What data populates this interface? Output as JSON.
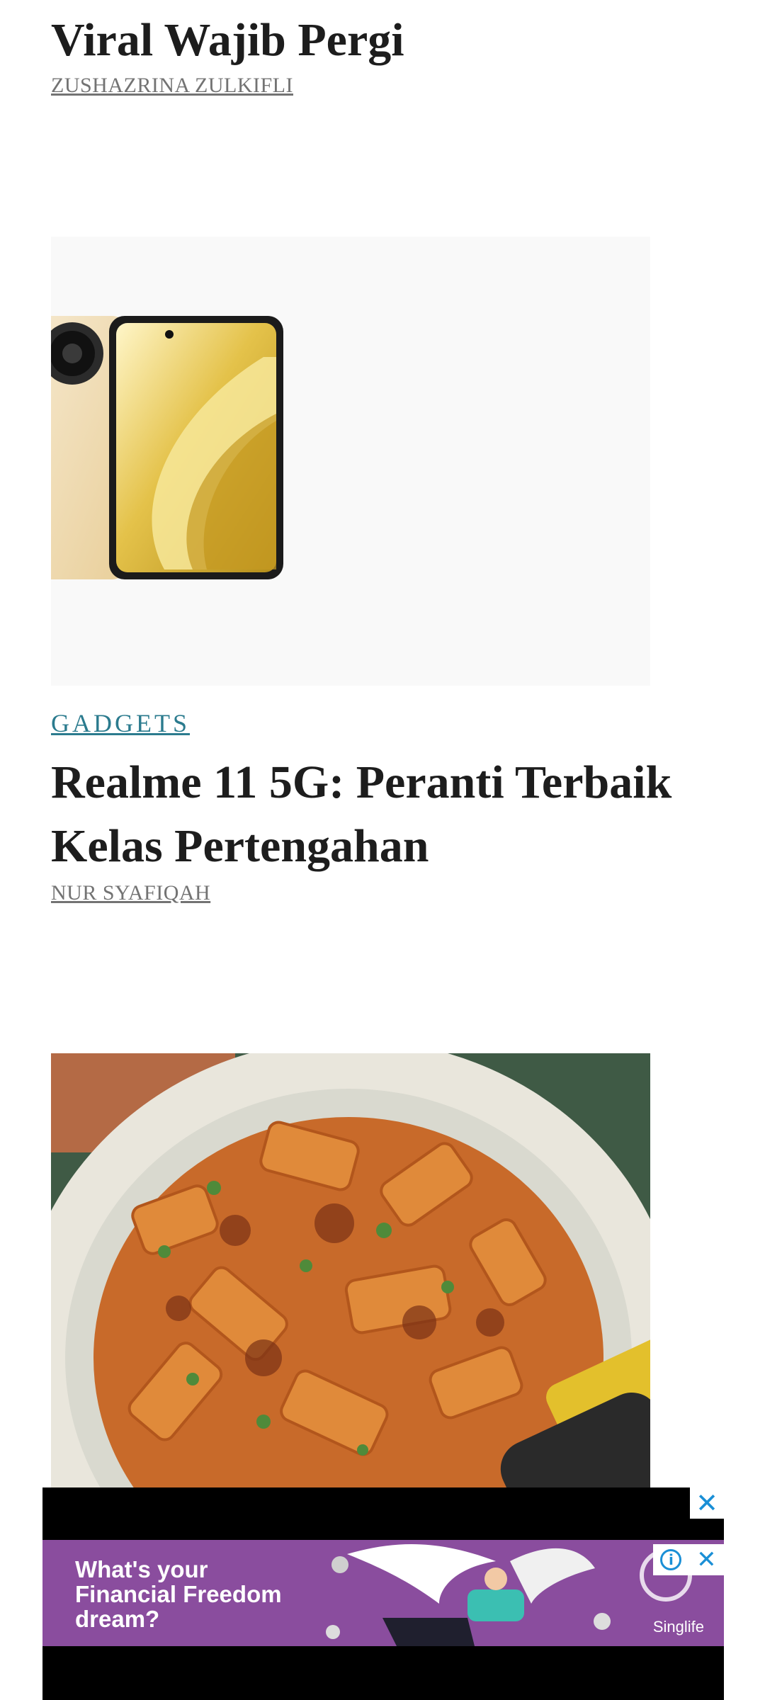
{
  "articles": [
    {
      "title": "Viral Wajib Pergi",
      "author": "ZUSHAZRINA ZULKIFLI"
    },
    {
      "category": "GADGETS",
      "title_line1": "Realme 11 5G: Peranti Terbaik",
      "title_line2": "Kelas Pertengahan",
      "author": "NUR SYAFIQAH"
    },
    {
      "image": "pasta-bolognese-photo"
    }
  ],
  "ad": {
    "text_line1": "What's your",
    "text_line2": "Financial Freedom",
    "text_line3": "dream?",
    "brand": "Singlife",
    "close_icon": "close-icon",
    "info_icon": "info-icon"
  },
  "colors": {
    "category": "#2b7b8e",
    "author": "#737373",
    "ad_background": "#8a4d9e",
    "ad_icon": "#1a8fd6"
  }
}
